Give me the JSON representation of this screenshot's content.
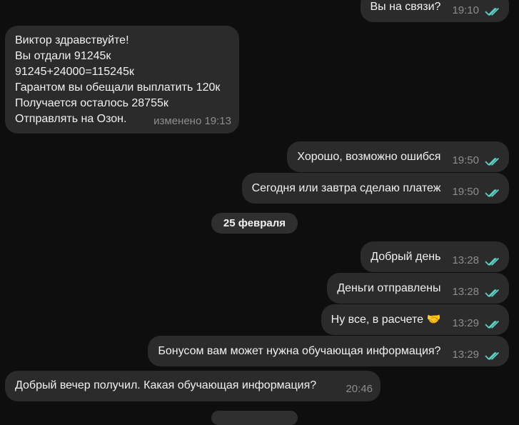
{
  "messages": [
    {
      "text": "Вы на связи?",
      "time": "19:10",
      "direction": "out",
      "status": "read"
    },
    {
      "text": "Виктор здравствуйте!\nВы отдали 91245к\n91245+24000=115245к\nГарантом вы обещали выплатить 120к\nПолучается осталось 28755к\nОтправлять на Озон.",
      "time": "изменено 19:13",
      "direction": "in"
    },
    {
      "text": "Хорошо, возможно ошибся",
      "time": "19:50",
      "direction": "out",
      "status": "read"
    },
    {
      "text": "Сегодня или завтра сделаю платеж",
      "time": "19:50",
      "direction": "out",
      "status": "read"
    },
    {
      "text": "Добрый день",
      "time": "13:28",
      "direction": "out",
      "status": "read"
    },
    {
      "text": "Деньги отправлены",
      "time": "13:28",
      "direction": "out",
      "status": "read"
    },
    {
      "text": "Ну все, в расчете 🤝",
      "time": "13:29",
      "direction": "out",
      "status": "read"
    },
    {
      "text": "Бонусом вам может нужна обучающая информация?",
      "time": "13:29",
      "direction": "out",
      "status": "read"
    },
    {
      "text": "Добрый вечер получил. Какая обучающая информация?",
      "time": "20:46",
      "direction": "in"
    }
  ],
  "date_separator": "25 февраля",
  "colors": {
    "background": "#0e0e0e",
    "bubble": "#2b2b2b",
    "date_pill": "#2f2f2f",
    "meta": "#8d8d8d",
    "read_check": "#5fd0c5"
  }
}
